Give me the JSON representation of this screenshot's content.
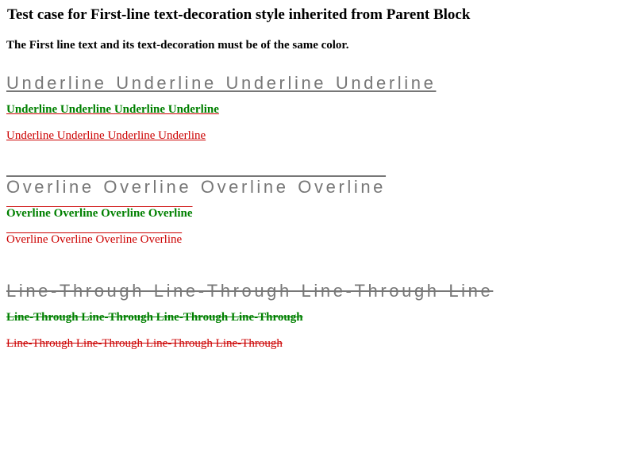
{
  "title": "Test case for First-line text-decoration style inherited from Parent Block",
  "subtitle": "The First line text and its text-decoration must be of the same color.",
  "underline": {
    "big": "Underline Underline Underline Underline",
    "green": "Underline Underline Underline Underline",
    "red": "Underline Underline Underline Underline"
  },
  "overline": {
    "big": "Overline Overline Overline Overline",
    "green": "Overline Overline Overline Overline",
    "red": "Overline Overline Overline Overline"
  },
  "linethrough": {
    "big": "Line-Through Line-Through Line-Through Line",
    "green": "Line-Through Line-Through Line-Through Line-Through",
    "red": "Line-Through Line-Through Line-Through Line-Through"
  },
  "colors": {
    "gray": "#777777",
    "green": "#008000",
    "red": "#cc0000"
  }
}
